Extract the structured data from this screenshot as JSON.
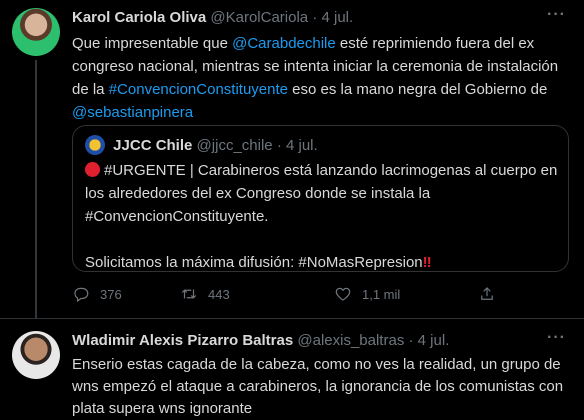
{
  "tweet1": {
    "name": "Karol Cariola Oliva",
    "handle": "@KarolCariola",
    "dot": "·",
    "date": "4 jul.",
    "more": "···",
    "text": {
      "l1a": "Que impresentable que ",
      "l1link": "@Carabdechile",
      "l1b": " esté reprimiendo fuera del ex",
      "l2": "congreso nacional, mientras se intenta iniciar la ceremonia de instalación",
      "l3a": "de la ",
      "l3link": "#ConvencionConstituyente",
      "l3b": " eso es la mano negra del Gobierno de",
      "l4link": "@sebastianpinera"
    },
    "quote": {
      "name": "JJCC Chile",
      "handle": "@jjcc_chile",
      "dot": "·",
      "date": "4 jul.",
      "l1": "#URGENTE | Carabineros está lanzando lacrimogenas al cuerpo en",
      "l2": "los alrededores del ex Congreso donde se instala la",
      "l3": "#ConvencionConstituyente.",
      "l5": "Solicitamos la máxima difusión: #NoMasRepresion",
      "bangs": "‼"
    },
    "actions": {
      "replies": "376",
      "retweets": "443",
      "likes": "1,1 mil"
    }
  },
  "tweet2": {
    "name": "Wladimir Alexis Pizarro Baltras",
    "handle": "@alexis_baltras",
    "dot": "·",
    "date": "4 jul.",
    "more": "···",
    "l1": "Enserio estas cagada de la cabeza, como no ves la realidad, un grupo de",
    "l2": "wns empezó el ataque a carabineros, la ignorancia de los comunistas con",
    "l3": "plata supera wns ignorante"
  }
}
